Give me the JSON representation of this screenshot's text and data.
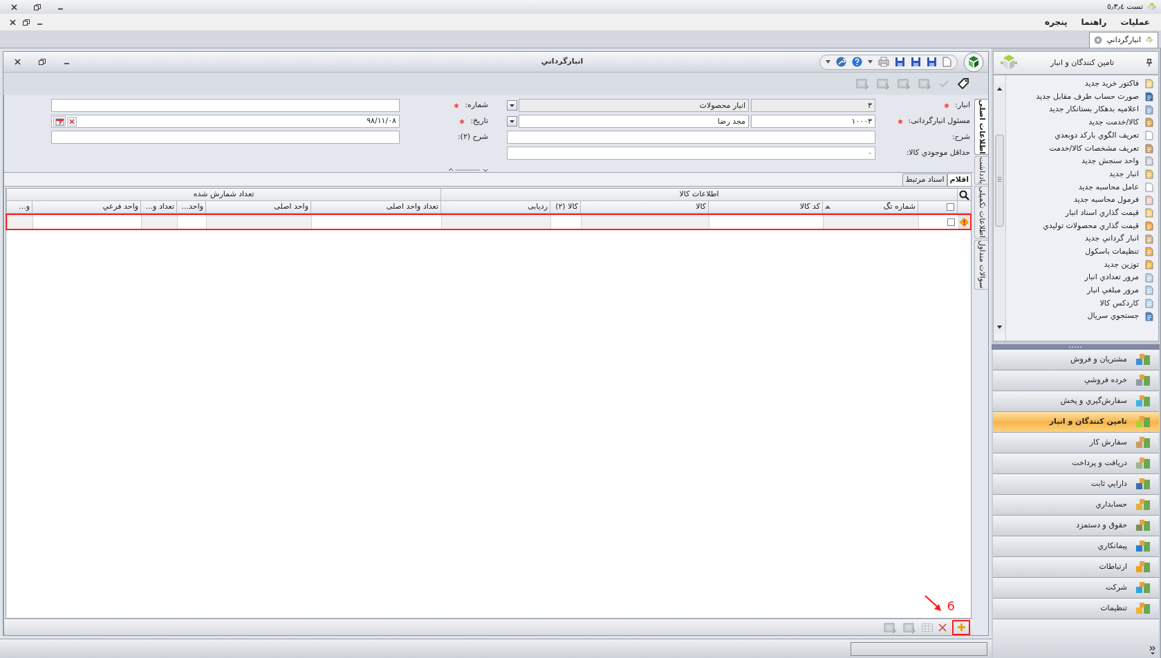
{
  "app_title": "تست ٥٫٣٫٤",
  "menu": [
    {
      "label": "عمليات"
    },
    {
      "label": "راهنما"
    },
    {
      "label": "پنجره"
    }
  ],
  "document_tabs": [
    {
      "label": "انبارگرداني",
      "selected": true
    }
  ],
  "window": {
    "title": "انبارگرداني",
    "side_tabs": [
      {
        "label": "اطلاعات اصلی",
        "selected": true
      },
      {
        "label": "یادداشت",
        "selected": false
      },
      {
        "label": "اطلاعات تکمیلی",
        "selected": false
      },
      {
        "label": "سوالات متداول",
        "selected": false
      }
    ],
    "form_right": [
      {
        "kind": "pair",
        "label": "انبار:",
        "required": true,
        "readonly": true,
        "code": "۳",
        "value": "انبار محصولات"
      },
      {
        "kind": "pair",
        "label": "مسئول انبارگردانی:",
        "required": true,
        "readonly": false,
        "code": "۱۰۰۰۳",
        "value": "مجد رضا"
      },
      {
        "kind": "text",
        "label": "شرح:",
        "required": false
      },
      {
        "kind": "text",
        "label": "حداقل موجودي كالا:",
        "required": false,
        "value": "۰"
      }
    ],
    "form_left": [
      {
        "kind": "text",
        "label": "شماره:",
        "required": true
      },
      {
        "kind": "date",
        "label": "تاریخ:",
        "required": true,
        "value": "۹۸/۱۱/۰۸"
      },
      {
        "kind": "text",
        "label": "شرح (۲):",
        "required": false
      }
    ],
    "grid": {
      "tabs": [
        {
          "label": "اقلام",
          "selected": true
        },
        {
          "label": "اسناد مرتبط",
          "selected": false
        }
      ],
      "select_all": {
        "checked": false
      },
      "groups": [
        {
          "label": "اطلاعات کالا",
          "columns": [
            {
              "label": "شماره تگ",
              "sorted": true
            },
            {
              "label": "کد کالا"
            },
            {
              "label": "کالا"
            },
            {
              "label": "کالا (۲)"
            },
            {
              "label": "ردیابی"
            }
          ]
        },
        {
          "label": "تعداد شمارش شده",
          "columns": [
            {
              "label": "تعداد واحد اصلی"
            },
            {
              "label": "واحد اصلی"
            },
            {
              "label": "واحد..."
            },
            {
              "label": "تعداد و..."
            },
            {
              "label": "واحد فرعي"
            },
            {
              "label": "و..."
            }
          ]
        }
      ],
      "rows": [
        {
          "checked": false
        }
      ]
    },
    "annotation": {
      "label": "6"
    }
  },
  "sidebar": {
    "title": "تامین کنندگان و انبار",
    "items": [
      {
        "label": "فاكتور خريد جديد"
      },
      {
        "label": "صورت حساب طرف مقابل جديد"
      },
      {
        "label": "اعلاميه بدهكار بستانكار جديد"
      },
      {
        "label": "كالا/خدمت جديد"
      },
      {
        "label": "تعريف الگوي باركد دوبعدي"
      },
      {
        "label": "تعريف مشخصات كالا/خدمت"
      },
      {
        "label": "واحد سنجش جديد"
      },
      {
        "label": "انبار جديد"
      },
      {
        "label": "عامل محاسبه جديد"
      },
      {
        "label": "فرمول محاسبه جديد"
      },
      {
        "label": "قيمت گذاري اسناد انبار"
      },
      {
        "label": "قيمت گذاري محصولات توليدي"
      },
      {
        "label": "انبار گرداني جديد"
      },
      {
        "label": "تنظيمات باسكول"
      },
      {
        "label": "توزين جديد"
      },
      {
        "label": "مرور تعدادي انبار"
      },
      {
        "label": "مرور مبلغي انبار"
      },
      {
        "label": "كاردكس كالا"
      },
      {
        "label": "جستجوي سريال"
      }
    ],
    "modules": [
      {
        "label": "مشتريان و فروش",
        "selected": false
      },
      {
        "label": "خرده فروشي",
        "selected": false
      },
      {
        "label": "سفارش‌گيري و پخش",
        "selected": false
      },
      {
        "label": "تامين كنندگان و انبار",
        "selected": true
      },
      {
        "label": "سفارش كار",
        "selected": false
      },
      {
        "label": "دريافت و پرداخت",
        "selected": false
      },
      {
        "label": "دارايي ثابت",
        "selected": false
      },
      {
        "label": "حسابداري",
        "selected": false
      },
      {
        "label": "حقوق و دستمزد",
        "selected": false
      },
      {
        "label": "پيمانكاري",
        "selected": false
      },
      {
        "label": "ارتباطات",
        "selected": false
      },
      {
        "label": "شركت",
        "selected": false
      },
      {
        "label": "تنظيمات",
        "selected": false
      }
    ]
  }
}
